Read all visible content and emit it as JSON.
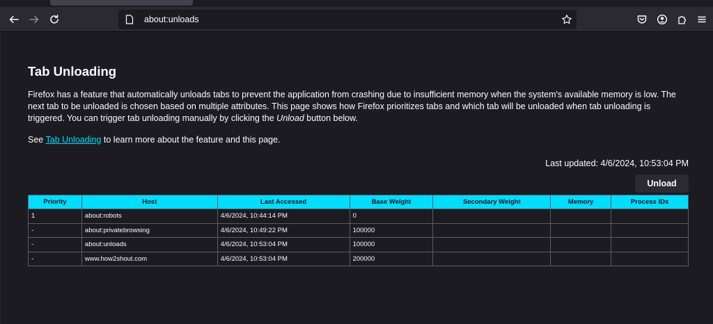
{
  "browser": {
    "url": "about:unloads"
  },
  "page": {
    "title": "Tab Unloading",
    "description_part1": "Firefox has a feature that automatically unloads tabs to prevent the application from crashing due to insufficient memory when the system's available memory is low. The next tab to be unloaded is chosen based on multiple attributes. This page shows how Firefox prioritizes tabs and which tab will be unloaded when tab unloading is triggered. You can trigger tab unloading manually by clicking the ",
    "description_emphasis": "Unload",
    "description_part2": " button below.",
    "see_prefix": "See ",
    "see_link": "Tab Unloading",
    "see_suffix": " to learn more about the feature and this page.",
    "last_updated": "Last updated: 4/6/2024, 10:53:04 PM",
    "unload_button": "Unload"
  },
  "table": {
    "headers": [
      "Priority",
      "Host",
      "Last Accessed",
      "Base Weight",
      "Secondary Weight",
      "Memory",
      "Process IDs"
    ],
    "rows": [
      [
        "1",
        "about:robots",
        "4/6/2024, 10:44:14 PM",
        "0",
        "",
        "",
        ""
      ],
      [
        "-",
        "about:privatebrowsing",
        "4/6/2024, 10:49:22 PM",
        "100000",
        "",
        "",
        ""
      ],
      [
        "-",
        "about:unloads",
        "4/6/2024, 10:53:04 PM",
        "100000",
        "",
        "",
        ""
      ],
      [
        "-",
        "www.how2shout.com",
        "4/6/2024, 10:53:04 PM",
        "200000",
        "",
        "",
        ""
      ]
    ]
  },
  "colors": {
    "accent": "#00ddff",
    "background": "#1c1b22",
    "toolbar": "#2b2a33"
  }
}
